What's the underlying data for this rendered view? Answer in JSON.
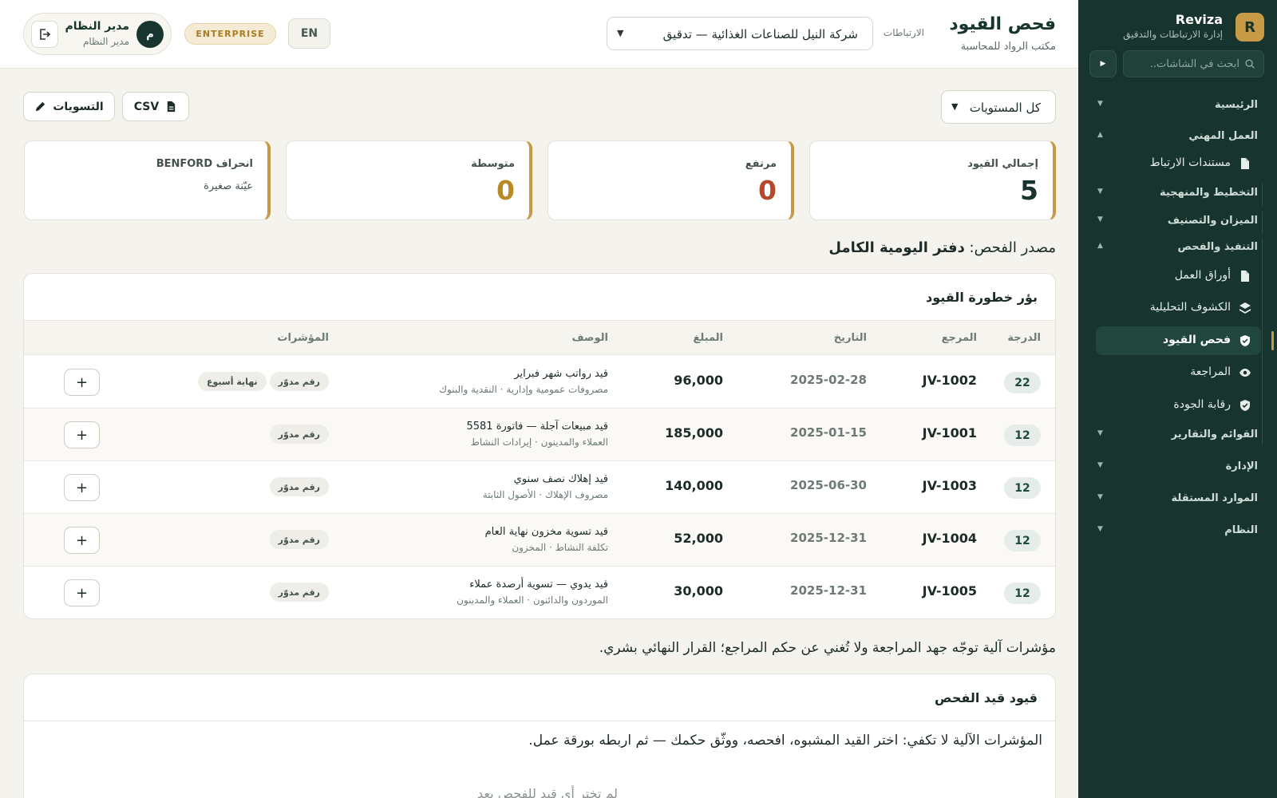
{
  "brand": {
    "logo": "R",
    "name": "Reviza",
    "tagline": "إدارة الارتباطات والتدقيق"
  },
  "sidebar": {
    "search_placeholder": "ابحث في الشاشات..",
    "sections": {
      "home": "الرئيسية",
      "professional": "العمل المهني",
      "planning": "التخطيط والمنهجية",
      "balance": "الميزان والتصنيف",
      "execution": "التنفيذ والفحص",
      "reports": "القوائم والتقارير",
      "admin": "الإدارة",
      "independent": "الموارد المستقلة",
      "system": "النظام"
    },
    "items": {
      "engagement_docs": "مستندات الارتباط",
      "workpapers": "أوراق العمل",
      "analytics": "الكشوف التحليلية",
      "journal_testing": "فحص القيود",
      "review": "المراجعة",
      "quality": "رقابة الجودة"
    }
  },
  "header": {
    "title": "فحص القيود",
    "subtitle": "مكتب الرواد للمحاسبة",
    "engagement_label": "الارتباطات",
    "engagement_value": "شركة النيل للصناعات الغذائية — تدقيق",
    "lang": "EN",
    "plan": "ENTERPRISE",
    "user_initial": "م",
    "user_name": "مدير النظام",
    "user_role": "مدير النظام"
  },
  "filters": {
    "level": "كل المستويات"
  },
  "toolbar": {
    "adjustments": "التسويات",
    "csv": "CSV"
  },
  "stats": {
    "total_label": "إجمالي القيود",
    "total_value": "5",
    "high_label": "مرتفع",
    "high_value": "0",
    "medium_label": "متوسطة",
    "medium_value": "0",
    "benford_label": "انحراف BENFORD",
    "benford_note": "عيّنة صغيرة"
  },
  "source": {
    "label": "مصدر الفحص:",
    "value": "دفتر اليومية الكامل"
  },
  "table": {
    "title": "بؤر خطورة القيود",
    "headers": {
      "score": "الدرجة",
      "ref": "المرجع",
      "date": "التاريخ",
      "amount": "المبلغ",
      "desc": "الوصف",
      "indicators": "المؤشرات"
    },
    "rows": [
      {
        "score": "22",
        "ref": "JV-1002",
        "date": "2025-02-28",
        "amount": "96,000",
        "desc": "قيد رواتب شهر فبراير",
        "accounts": "مصروفات عمومية وإدارية · النقدية والبنوك",
        "tags": [
          "رقم مدوّر",
          "نهاية أسبوع"
        ]
      },
      {
        "score": "12",
        "ref": "JV-1001",
        "date": "2025-01-15",
        "amount": "185,000",
        "desc": "قيد مبيعات آجلة — فاتورة 5581",
        "accounts": "العملاء والمدينون · إيرادات النشاط",
        "tags": [
          "رقم مدوّر"
        ]
      },
      {
        "score": "12",
        "ref": "JV-1003",
        "date": "2025-06-30",
        "amount": "140,000",
        "desc": "قيد إهلاك نصف سنوي",
        "accounts": "مصروف الإهلاك · الأصول الثابتة",
        "tags": [
          "رقم مدوّر"
        ]
      },
      {
        "score": "12",
        "ref": "JV-1004",
        "date": "2025-12-31",
        "amount": "52,000",
        "desc": "قيد تسوية مخزون نهاية العام",
        "accounts": "تكلفة النشاط · المخزون",
        "tags": [
          "رقم مدوّر"
        ]
      },
      {
        "score": "12",
        "ref": "JV-1005",
        "date": "2025-12-31",
        "amount": "30,000",
        "desc": "قيد يدوي — تسوية أرصدة عملاء",
        "accounts": "الموردون والدائنون · العملاء والمدينون",
        "tags": [
          "رقم مدوّر"
        ]
      }
    ],
    "add_symbol": "+"
  },
  "disclaimer": "مؤشرات آلية توجّه جهد المراجعة ولا تُغني عن حكم المراجع؛ القرار النهائي بشري.",
  "review_panel": {
    "title": "قيود قيد الفحص",
    "instruction": "المؤشرات الآلية لا تكفي: اختر القيد المشبوه، افحصه، ووثّق حكمك — ثم اربطه بورقة عمل.",
    "empty": "لم تختر أي قيد للفحص بعد"
  },
  "colors": {
    "sidebar": "#17352e",
    "accent": "#c79a45",
    "high": "#b5492c",
    "medium": "#b88a25"
  }
}
